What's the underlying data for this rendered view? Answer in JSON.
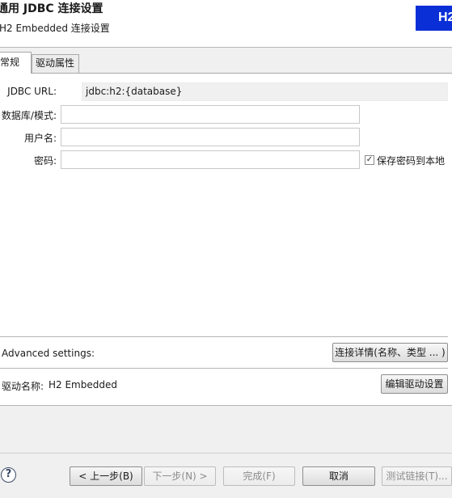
{
  "header": {
    "title": "通用 JDBC 连接设置",
    "subtitle": "H2 Embedded 连接设置",
    "logo_text": "H2"
  },
  "tabs": [
    {
      "label": "常规",
      "active": true
    },
    {
      "label": "驱动属性",
      "active": false
    }
  ],
  "form": {
    "jdbc_url_label": "JDBC URL:",
    "jdbc_url_value": "jdbc:h2:{database}",
    "database_label": "数据库/模式:",
    "database_value": "",
    "username_label": "用户名:",
    "username_value": "",
    "password_label": "密码:",
    "password_value": "",
    "save_password_label": "保存密码到本地",
    "save_password_checked": true
  },
  "advanced": {
    "label": "Advanced settings:",
    "details_button": "连接详情(名称、类型 ... )"
  },
  "driver": {
    "name_label": "驱动名称:",
    "name_value": "H2 Embedded",
    "edit_button": "编辑驱动设置"
  },
  "footer": {
    "help_icon": "?",
    "back_button": "< 上一步(B)",
    "next_button": "下一步(N) >",
    "finish_button": "完成(F)",
    "cancel_button": "取消",
    "test_button": "测试链接(T)..."
  },
  "colors": {
    "logo_bg": "#0a2fd6",
    "panel_bg": "#f0f0f0"
  }
}
